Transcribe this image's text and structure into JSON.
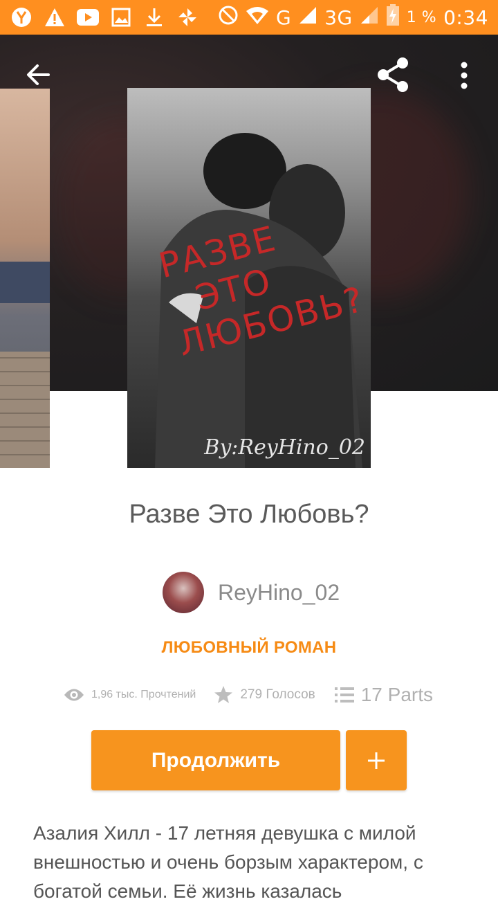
{
  "status_bar": {
    "battery_percent": "1 %",
    "time": "0:34",
    "network_g": "G",
    "network_3g": "3G",
    "icons": [
      "yandex-icon",
      "warning-icon",
      "youtube-icon",
      "image-icon",
      "download-icon",
      "pinwheel-icon",
      "block-icon",
      "wifi-icon",
      "signal-icon",
      "battery-charging-icon"
    ]
  },
  "toolbar": {
    "back_icon": "arrow-left-icon",
    "share_icon": "share-icon",
    "more_icon": "more-vert-icon"
  },
  "cover": {
    "title_lines": [
      "РАЗВЕ",
      "ЭТО",
      "ЛЮБОВЬ?"
    ],
    "byline": "By:ReyHino_02"
  },
  "story": {
    "title": "Разве Это Любовь?",
    "author": "ReyHino_02",
    "genre": "ЛЮБОВНЫЙ РОМАН",
    "reads": "1,96 тыс. Прочтений",
    "votes": "279 Голосов",
    "parts": "17 Parts",
    "continue_label": "Продолжить",
    "add_label": "+",
    "description": "Азалия Хилл - 17 летняя девушка с милой внешностью и очень борзым характером, с богатой семьи. Её жизнь казалась"
  },
  "colors": {
    "accent": "#f7941e",
    "status_bar": "#ff8f1f",
    "genre": "#f68b15"
  }
}
